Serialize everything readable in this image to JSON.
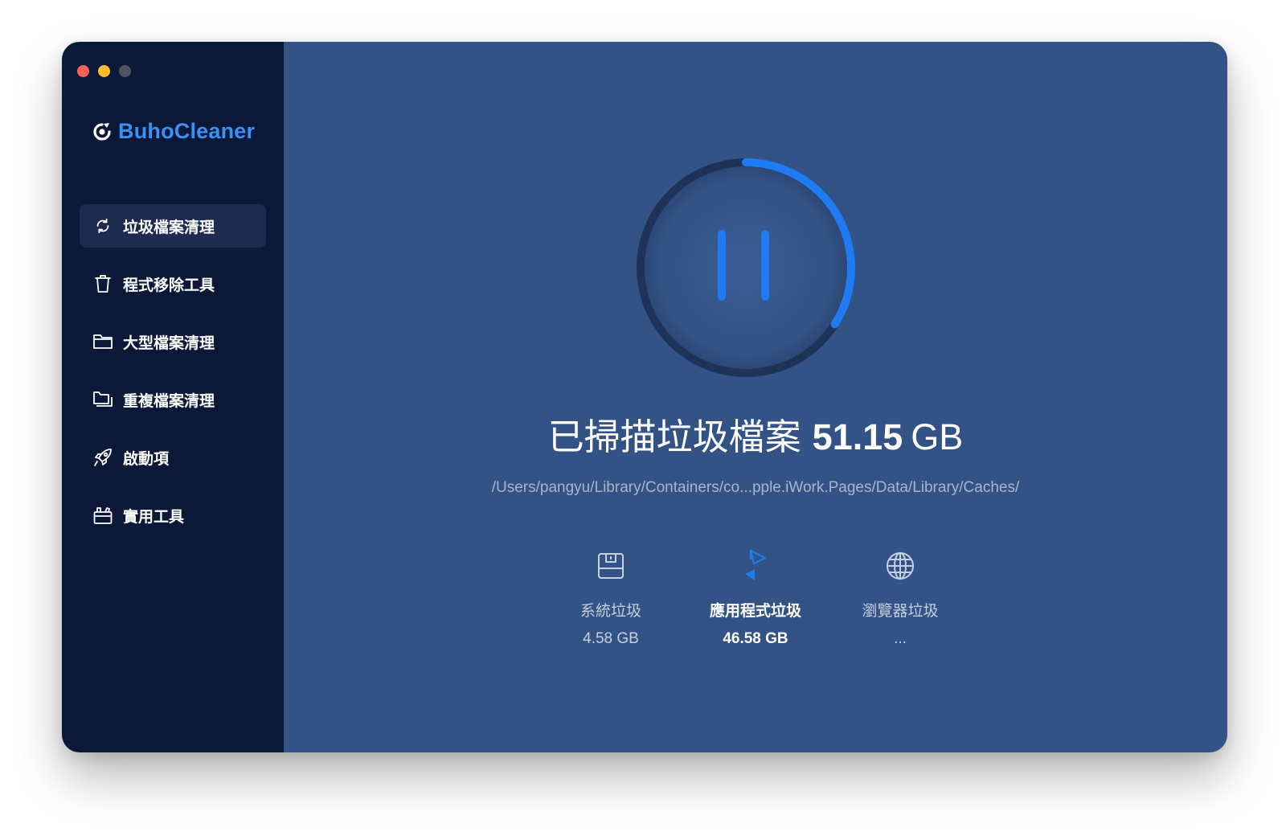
{
  "app": {
    "name": "BuhoCleaner",
    "brand_color": "#3b92f5",
    "logo_icon": "buho-logo-icon"
  },
  "window_controls": {
    "close_color": "#fe5f57",
    "minimize_color": "#febc2e",
    "zoom_color": "#4f5563"
  },
  "sidebar": {
    "items": [
      {
        "label": "垃圾檔案清理",
        "icon": "refresh-icon",
        "active": true
      },
      {
        "label": "程式移除工具",
        "icon": "trash-icon",
        "active": false
      },
      {
        "label": "大型檔案清理",
        "icon": "folder-icon",
        "active": false
      },
      {
        "label": "重複檔案清理",
        "icon": "duplicate-folder-icon",
        "active": false
      },
      {
        "label": "啟動項",
        "icon": "rocket-icon",
        "active": false
      },
      {
        "label": "實用工具",
        "icon": "toolbox-icon",
        "active": false
      }
    ]
  },
  "scan": {
    "headline": "已掃描垃圾檔案",
    "size_value": "51.15",
    "size_unit": "GB",
    "current_path": "/Users/pangyu/Library/Containers/co...pple.iWork.Pages/Data/Library/Caches/",
    "progress": 0.34,
    "progress_color": "#1f7bf2",
    "control_icon": "pause-icon"
  },
  "categories": [
    {
      "label": "系統垃圾",
      "value": "4.58 GB",
      "icon": "disk-icon",
      "active": false
    },
    {
      "label": "應用程式垃圾",
      "value": "46.58 GB",
      "icon": "app-store-icon",
      "active": true
    },
    {
      "label": "瀏覽器垃圾",
      "value": "...",
      "icon": "globe-icon",
      "active": false
    }
  ]
}
